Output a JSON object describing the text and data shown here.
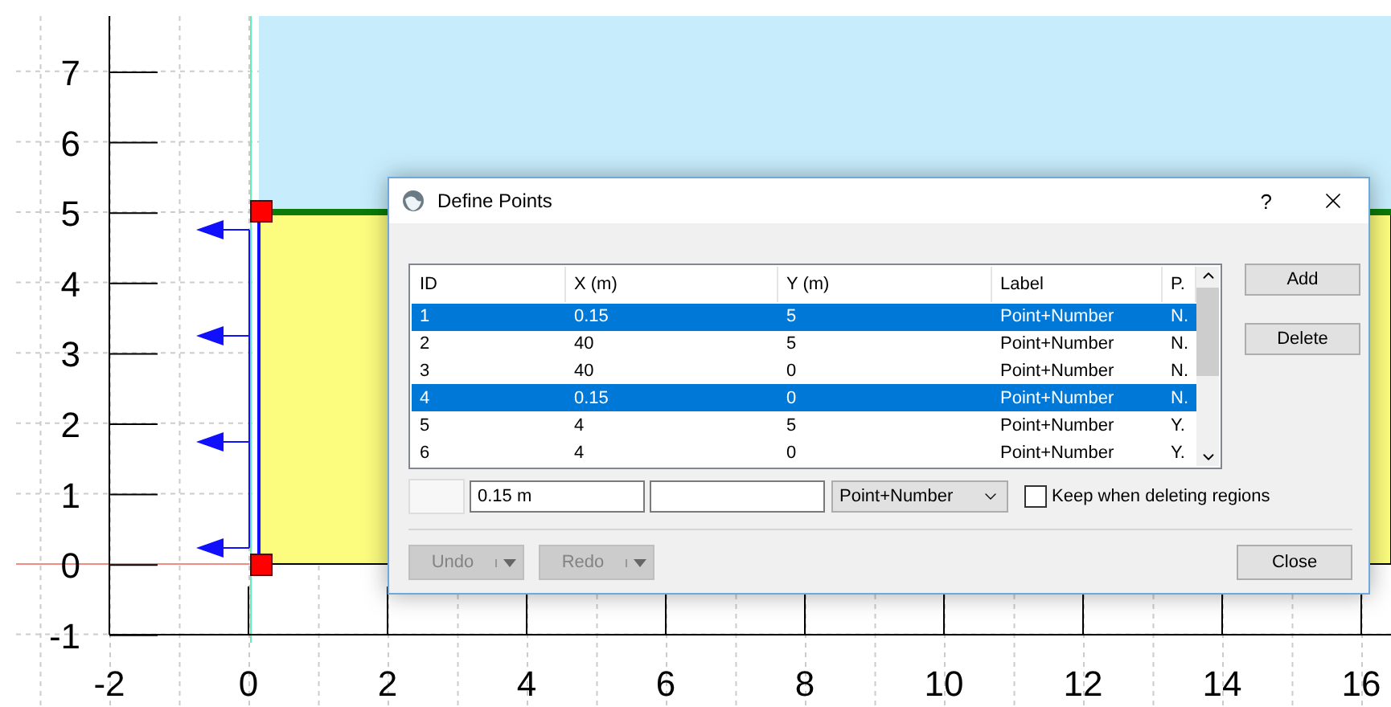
{
  "canvas": {
    "y_axis_labels": [
      "7",
      "6",
      "5",
      "4",
      "3",
      "2",
      "1",
      "0",
      "-1"
    ],
    "x_axis_labels": [
      "-2",
      "0",
      "2",
      "4",
      "6",
      "8",
      "10",
      "12",
      "14",
      "16"
    ]
  },
  "dialog": {
    "title": "Define Points",
    "help": "?",
    "table": {
      "columns": [
        "ID",
        "X (m)",
        "Y (m)",
        "Label",
        "P."
      ],
      "rows": [
        {
          "cells": [
            "1",
            "0.15",
            "5",
            "Point+Number",
            "N."
          ],
          "selected": true
        },
        {
          "cells": [
            "2",
            "40",
            "5",
            "Point+Number",
            "N."
          ],
          "selected": false
        },
        {
          "cells": [
            "3",
            "40",
            "0",
            "Point+Number",
            "N."
          ],
          "selected": false
        },
        {
          "cells": [
            "4",
            "0.15",
            "0",
            "Point+Number",
            "N."
          ],
          "selected": true
        },
        {
          "cells": [
            "5",
            "4",
            "5",
            "Point+Number",
            "Y."
          ],
          "selected": false
        },
        {
          "cells": [
            "6",
            "4",
            "0",
            "Point+Number",
            "Y."
          ],
          "selected": false
        }
      ]
    },
    "side_buttons": [
      "Add",
      "Delete"
    ],
    "editor": {
      "x_value": "0.15 m",
      "label_select": "Point+Number",
      "keep_checkbox": {
        "label": "Keep when deleting regions",
        "checked": false
      }
    },
    "undo": {
      "label": "Undo",
      "disabled": true
    },
    "redo": {
      "label": "Redo",
      "disabled": true
    },
    "close": "Close"
  }
}
